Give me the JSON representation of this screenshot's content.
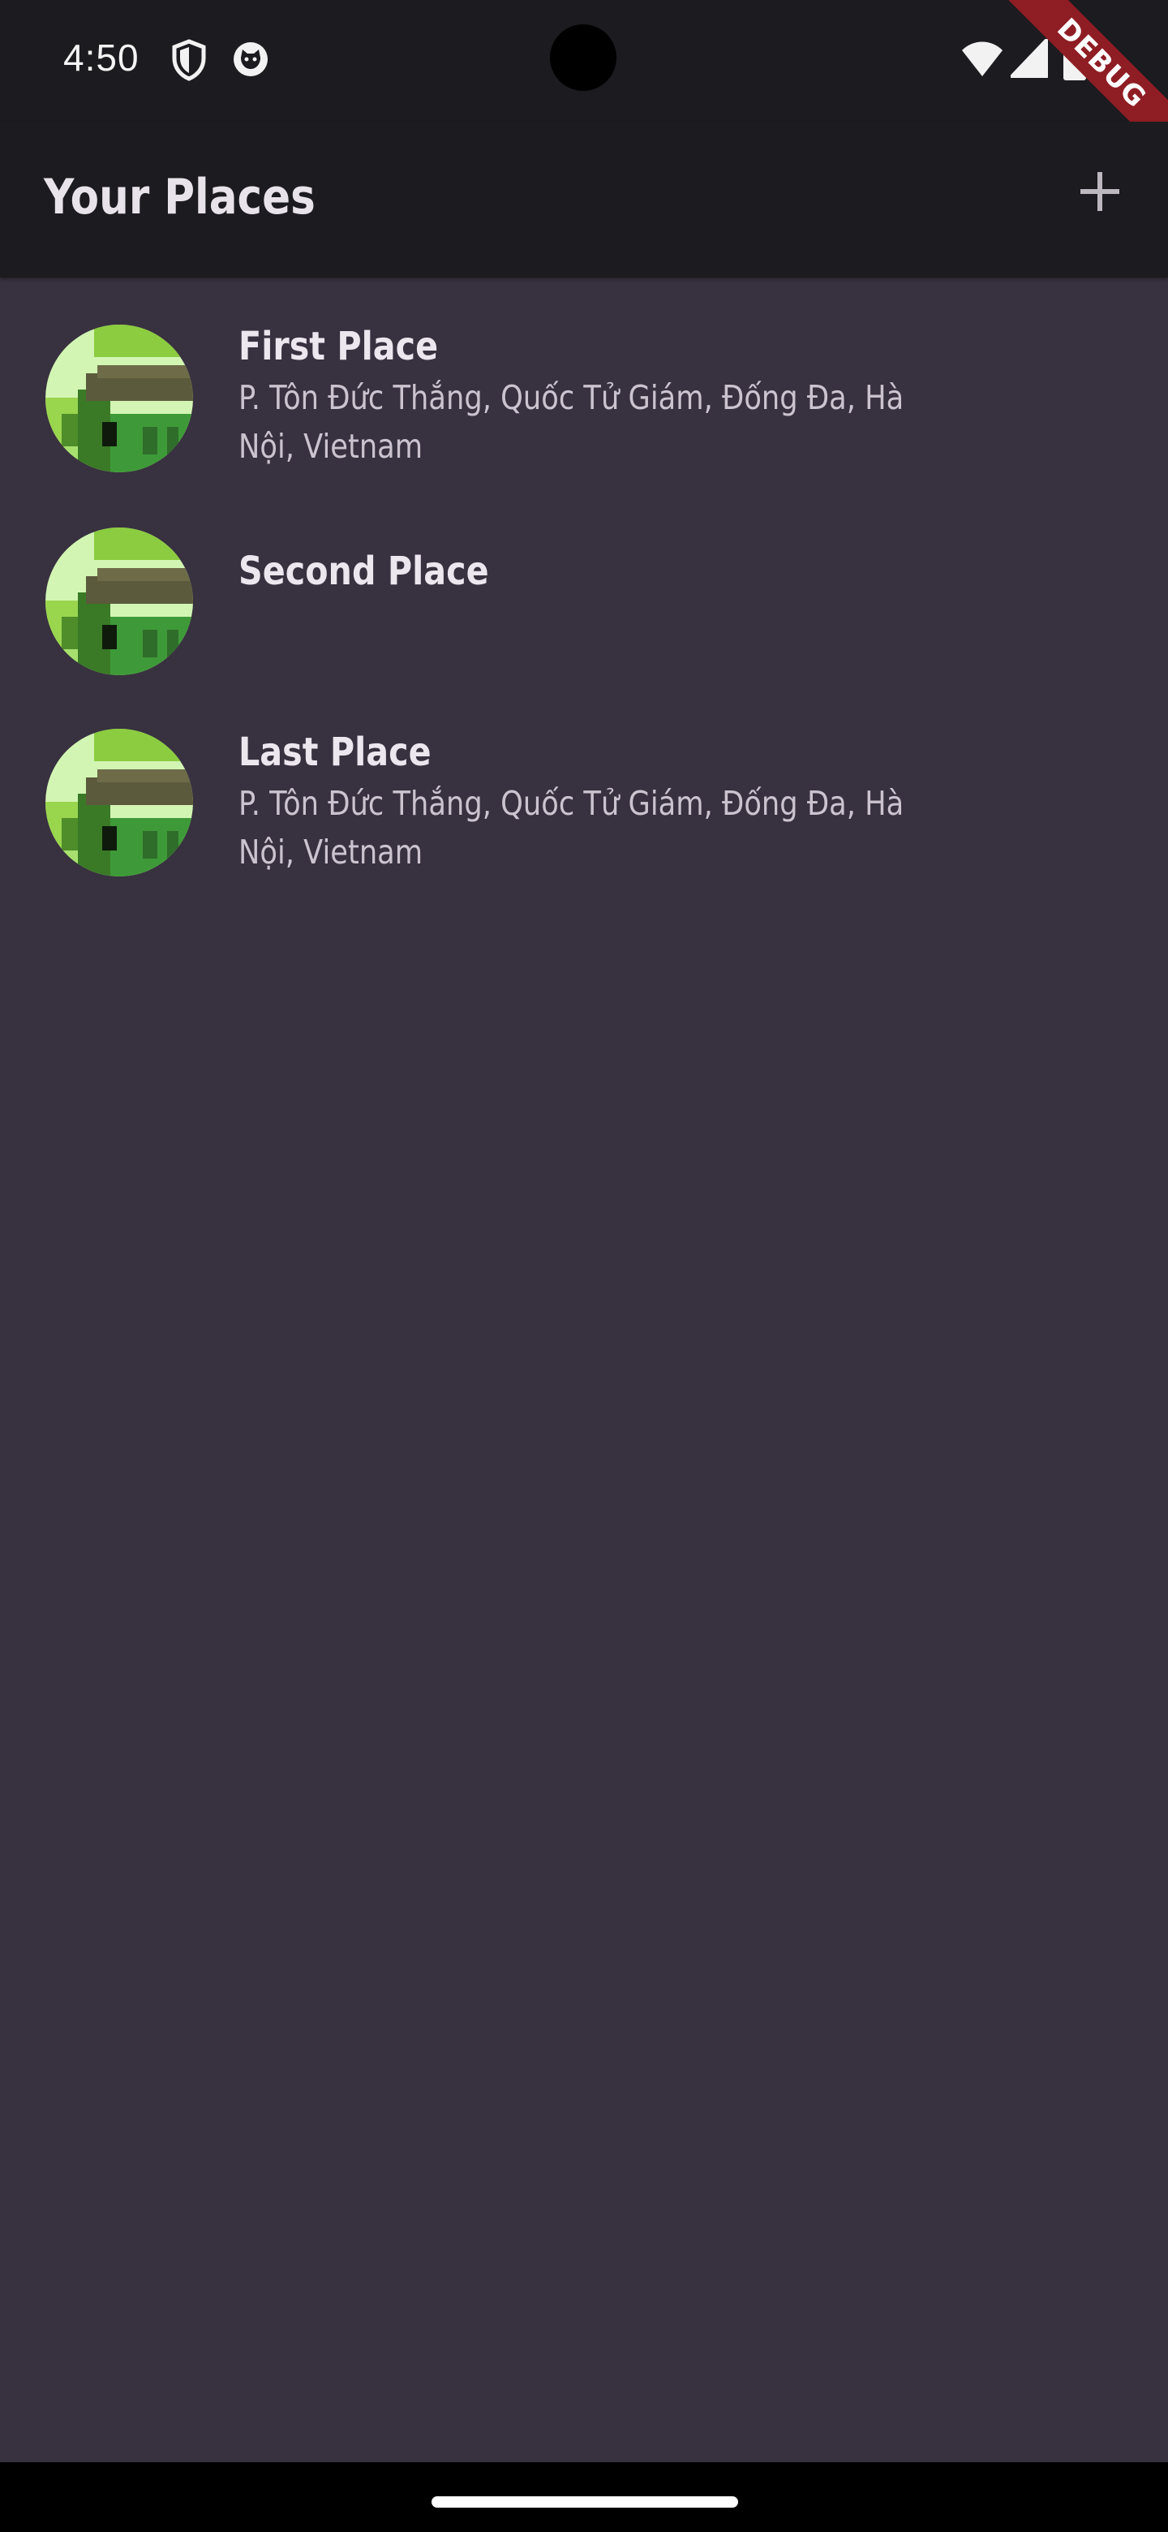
{
  "status_bar": {
    "time": "4:50",
    "icons": [
      "shield-icon",
      "cat-icon",
      "wifi-icon",
      "signal-icon",
      "battery-icon"
    ]
  },
  "debug_banner": "DEBUG",
  "app_bar": {
    "title": "Your Places",
    "add_icon": "plus-icon"
  },
  "places": [
    {
      "title": "First Place",
      "address": "P. Tôn Đức Thắng, Quốc Tử Giám, Đống Đa, Hà Nội, Vietnam"
    },
    {
      "title": "Second Place",
      "address": ""
    },
    {
      "title": "Last Place",
      "address": "P. Tôn Đức Thắng, Quốc Tử Giám, Đống Đa, Hà Nội, Vietnam"
    }
  ],
  "colors": {
    "background": "#38313f",
    "app_bar": "#1c1b1f",
    "title_text": "#e8e3ea",
    "subtitle_text": "#cbc4cf",
    "debug_banner": "#8f1d24"
  }
}
